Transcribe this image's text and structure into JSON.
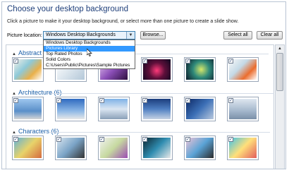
{
  "header": {
    "title": "Choose your desktop background",
    "instructions": "Click a picture to make it your desktop background, or select more than one picture to create a slide show."
  },
  "location": {
    "label": "Picture location:",
    "selected": "Windows Desktop Backgrounds",
    "options": [
      "Windows Desktop Backgrounds",
      "Pictures Library",
      "Top Rated Photos",
      "Solid Colors",
      "C:\\Users\\Public\\Pictures\\Sample Pictures"
    ],
    "highlighted_index": 1
  },
  "buttons": {
    "browse": "Browse...",
    "select_all": "Select all",
    "clear_all": "Clear all"
  },
  "groups": [
    {
      "label": "Abstract (6)"
    },
    {
      "label": "Architecture (6)"
    },
    {
      "label": "Characters (6)"
    }
  ],
  "check_glyph": "✓",
  "colors": {
    "accent": "#1b5fa8",
    "highlight": "#3399ff"
  }
}
